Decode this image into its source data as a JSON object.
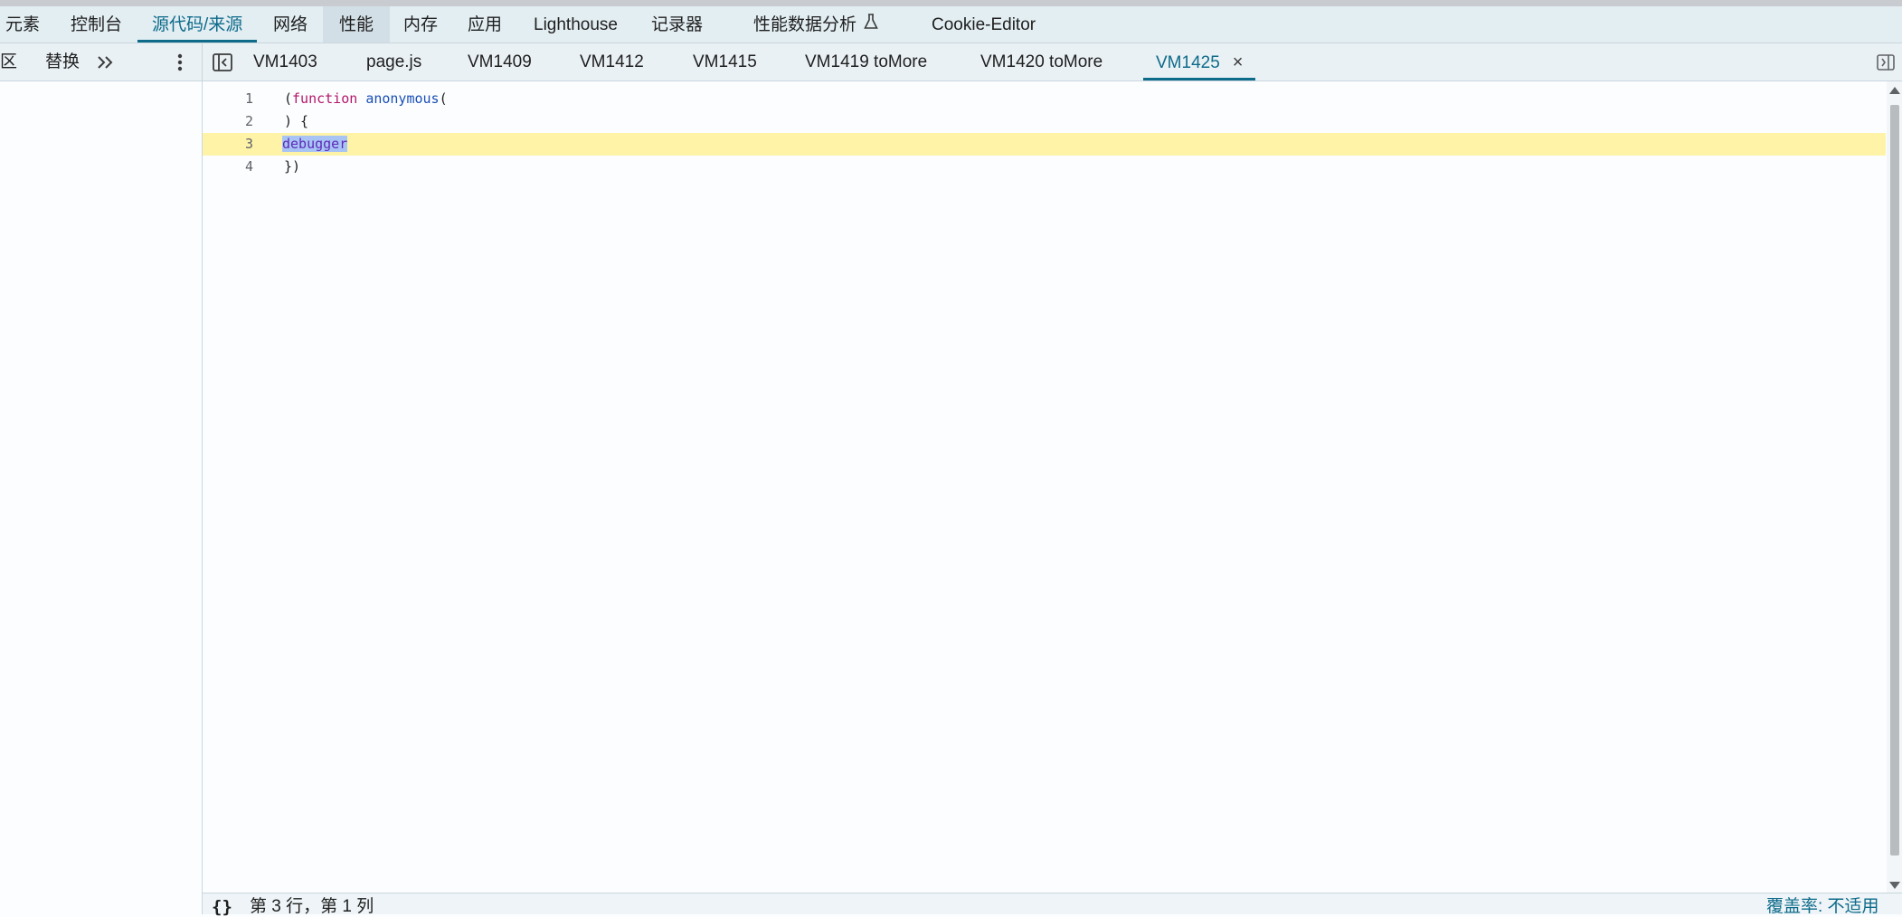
{
  "panel_tabs": [
    {
      "label": "元素"
    },
    {
      "label": "控制台"
    },
    {
      "label": "源代码/来源",
      "active": true
    },
    {
      "label": "网络"
    },
    {
      "label": "性能",
      "hover": true
    },
    {
      "label": "内存"
    },
    {
      "label": "应用"
    },
    {
      "label": "Lighthouse"
    },
    {
      "label": "记录器"
    },
    {
      "label": "性能数据分析",
      "icon": "flask-icon"
    },
    {
      "label": "Cookie-Editor"
    }
  ],
  "sources_subtabs": {
    "workspace_partial": "区",
    "overrides": "替换",
    "more_icon": "double-chevron-right-icon",
    "menu_icon": "vertical-ellipsis-icon"
  },
  "file_tabs": [
    {
      "label": "VM1403"
    },
    {
      "label": "page.js"
    },
    {
      "label": "VM1409"
    },
    {
      "label": "VM1412"
    },
    {
      "label": "VM1415"
    },
    {
      "label": "VM1419 toMore"
    },
    {
      "label": "VM1420 toMore"
    },
    {
      "label": "VM1425",
      "active": true,
      "closable": true,
      "close_glyph": "×"
    }
  ],
  "editor": {
    "lines": [
      {
        "number": "1",
        "paren": "(",
        "keyword": "function",
        "name": "anonymous",
        "rest": "("
      },
      {
        "number": "2",
        "text": ") {"
      },
      {
        "number": "3",
        "selected": "debugger",
        "highlighted": true
      },
      {
        "number": "4",
        "text": "})"
      }
    ]
  },
  "status": {
    "format_icon": "curly-braces-icon",
    "format_glyph": "{}",
    "position": "第 3 行，第 1 列",
    "coverage": "覆盖率: 不适用"
  },
  "colors": {
    "accent": "#0e6b8a",
    "highlight_line": "#fff3a8",
    "keyword": "#b5176b",
    "function_name": "#1a4fb4"
  }
}
